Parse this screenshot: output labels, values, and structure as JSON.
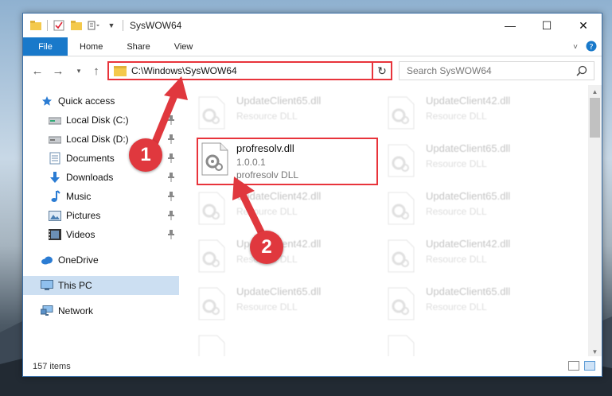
{
  "window": {
    "title": "SysWOW64",
    "controls": {
      "minimize": "—",
      "maximize": "☐",
      "close": "✕"
    }
  },
  "ribbon": {
    "file_tab": "File",
    "tabs": [
      "Home",
      "Share",
      "View"
    ]
  },
  "address_bar": {
    "path": "C:\\Windows\\SysWOW64",
    "search_placeholder": "Search SysWOW64"
  },
  "nav_pane": {
    "items": [
      {
        "label": "Quick access",
        "icon": "star-icon"
      },
      {
        "label": "Local Disk (C:)",
        "icon": "drive-icon",
        "pinned": true
      },
      {
        "label": "Local Disk (D:)",
        "icon": "drive-icon",
        "pinned": true
      },
      {
        "label": "Documents",
        "icon": "documents-icon",
        "pinned": true
      },
      {
        "label": "Downloads",
        "icon": "downloads-icon",
        "pinned": true
      },
      {
        "label": "Music",
        "icon": "music-icon",
        "pinned": true
      },
      {
        "label": "Pictures",
        "icon": "pictures-icon",
        "pinned": true
      },
      {
        "label": "Videos",
        "icon": "videos-icon",
        "pinned": true
      },
      {
        "label": "OneDrive",
        "icon": "cloud-icon"
      },
      {
        "label": "This PC",
        "icon": "computer-icon",
        "selected": true
      },
      {
        "label": "Network",
        "icon": "network-icon"
      }
    ]
  },
  "files": [
    {
      "name": "UpdateClient65.dll",
      "line1": "Resource DLL",
      "line2": ""
    },
    {
      "name": "UpdateClient42.dll",
      "line1": "Resource DLL",
      "line2": ""
    },
    {
      "name": "profresolv.dll",
      "line1": "1.0.0.1",
      "line2": "profresolv DLL",
      "selected": true
    },
    {
      "name": "UpdateClient65.dll",
      "line1": "Resource DLL",
      "line2": ""
    },
    {
      "name": "UpdateClient42.dll",
      "line1": "Resource DLL",
      "line2": ""
    },
    {
      "name": "UpdateClient65.dll",
      "line1": "Resource DLL",
      "line2": ""
    },
    {
      "name": "UpdateClient42.dll",
      "line1": "Resource DLL",
      "line2": ""
    },
    {
      "name": "UpdateClient42.dll",
      "line1": "Resource DLL",
      "line2": ""
    },
    {
      "name": "UpdateClient65.dll",
      "line1": "Resource DLL",
      "line2": ""
    },
    {
      "name": "UpdateClient65.dll",
      "line1": "Resource DLL",
      "line2": ""
    }
  ],
  "status": {
    "item_count": "157 items"
  },
  "annotations": {
    "step1": "1",
    "step2": "2"
  },
  "colors": {
    "accent": "#1979ca",
    "highlight_red": "#e8343b",
    "selection": "#ccdff2"
  }
}
